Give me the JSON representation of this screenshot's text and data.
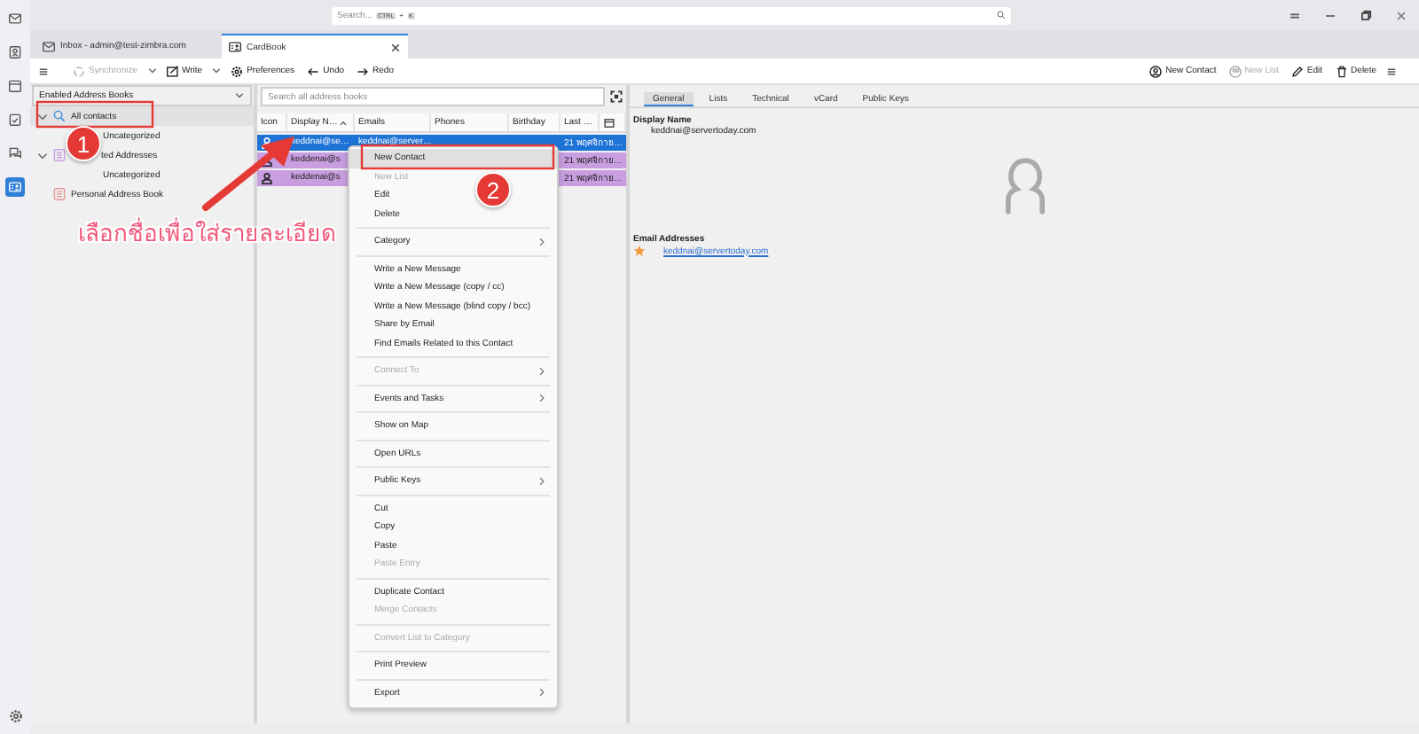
{
  "spaces_bar": {
    "items": [
      {
        "kind": "mail",
        "selected": false
      },
      {
        "kind": "addressbook",
        "selected": false
      },
      {
        "kind": "calendar",
        "selected": false
      },
      {
        "kind": "tasks",
        "selected": false
      },
      {
        "kind": "chat",
        "selected": false
      },
      {
        "kind": "cardbook",
        "selected": true
      }
    ]
  },
  "search": {
    "placeholder": "Search...",
    "shortcut": [
      "CTRL",
      "+",
      "K"
    ]
  },
  "tabs": [
    {
      "label": "Inbox - admin@test-zimbra.com",
      "kind": "mail",
      "selected": false
    },
    {
      "label": "CardBook",
      "kind": "cardbook",
      "selected": true
    }
  ],
  "toolbar": {
    "left": [
      {
        "label": "Synchronize",
        "kind": "sync",
        "disabled": true,
        "has_menu": true
      },
      {
        "label": "Write",
        "kind": "write",
        "disabled": false,
        "has_menu": true
      },
      {
        "label": "Preferences",
        "kind": "prefs",
        "disabled": false,
        "has_menu": false
      },
      {
        "label": "Undo",
        "kind": "undo",
        "disabled": false,
        "has_menu": false
      },
      {
        "label": "Redo",
        "kind": "redo",
        "disabled": false,
        "has_menu": false
      }
    ],
    "right": [
      {
        "label": "New Contact",
        "kind": "new-contact",
        "disabled": false
      },
      {
        "label": "New List",
        "kind": "new-list",
        "disabled": true
      },
      {
        "label": "Edit",
        "kind": "edit",
        "disabled": false
      },
      {
        "label": "Delete",
        "kind": "delete",
        "disabled": false
      }
    ]
  },
  "address_books": {
    "selector": "Enabled Address Books",
    "tree": [
      {
        "label": "All contacts",
        "kind": "search",
        "expanded": true,
        "selected": true,
        "children": [
          {
            "label": "Uncategorized",
            "selected": false
          }
        ]
      },
      {
        "label": "ted Addresses",
        "kind": "book",
        "color": "#c89ee0",
        "expanded": true,
        "selected": false,
        "children": [
          {
            "label": "Uncategorized",
            "selected": false
          }
        ]
      },
      {
        "label": "Personal Address Book",
        "kind": "book",
        "color": "#e89a9a",
        "selected": false
      }
    ]
  },
  "contacts": {
    "search_placeholder": "Search all address books",
    "columns": [
      {
        "label": "Icon",
        "sorted": false
      },
      {
        "label": "Display N…",
        "sorted": true
      },
      {
        "label": "Emails",
        "sorted": false
      },
      {
        "label": "Phones",
        "sorted": false
      },
      {
        "label": "Birthday",
        "sorted": false
      },
      {
        "label": "Last …",
        "sorted": false
      }
    ],
    "rows": [
      {
        "display_name": "keddnai@se…",
        "email": "keddnai@server…",
        "last": "21 พฤศจิกาย…",
        "selected": true
      },
      {
        "display_name": "keddenai@s",
        "last": "21 พฤศจิกาย…",
        "color": "#c89ee0",
        "selected": false
      },
      {
        "display_name": "keddenai@s",
        "last": "21 พฤศจิกาย…",
        "color": "#c89ee0",
        "selected": false
      }
    ]
  },
  "context_menu": {
    "items": [
      {
        "kind": "item",
        "label": "New Contact",
        "selected": true,
        "disabled": false
      },
      {
        "kind": "item",
        "label": "New List",
        "selected": false,
        "disabled": true
      },
      {
        "kind": "item",
        "label": "Edit",
        "selected": false,
        "disabled": false
      },
      {
        "kind": "item",
        "label": "Delete",
        "selected": false,
        "disabled": false
      },
      {
        "kind": "separator"
      },
      {
        "kind": "submenu",
        "label": "Category",
        "selected": false,
        "disabled": false
      },
      {
        "kind": "separator"
      },
      {
        "kind": "item",
        "label": "Write a New Message",
        "selected": false,
        "disabled": false
      },
      {
        "kind": "item",
        "label": "Write a New Message (copy / cc)",
        "selected": false,
        "disabled": false
      },
      {
        "kind": "item",
        "label": "Write a New Message (blind copy / bcc)",
        "selected": false,
        "disabled": false
      },
      {
        "kind": "item",
        "label": "Share by Email",
        "selected": false,
        "disabled": false
      },
      {
        "kind": "item",
        "label": "Find Emails Related to this Contact",
        "selected": false,
        "disabled": false
      },
      {
        "kind": "separator"
      },
      {
        "kind": "submenu",
        "label": "Connect To",
        "selected": false,
        "disabled": true
      },
      {
        "kind": "separator"
      },
      {
        "kind": "submenu",
        "label": "Events and Tasks",
        "selected": false,
        "disabled": false
      },
      {
        "kind": "separator"
      },
      {
        "kind": "item",
        "label": "Show on Map",
        "selected": false,
        "disabled": false
      },
      {
        "kind": "separator"
      },
      {
        "kind": "item",
        "label": "Open URLs",
        "selected": false,
        "disabled": false
      },
      {
        "kind": "separator"
      },
      {
        "kind": "submenu",
        "label": "Public Keys",
        "selected": false,
        "disabled": false
      },
      {
        "kind": "separator"
      },
      {
        "kind": "item",
        "label": "Cut",
        "selected": false,
        "disabled": false
      },
      {
        "kind": "item",
        "label": "Copy",
        "selected": false,
        "disabled": false
      },
      {
        "kind": "item",
        "label": "Paste",
        "selected": false,
        "disabled": false
      },
      {
        "kind": "item",
        "label": "Paste Entry",
        "selected": false,
        "disabled": true
      },
      {
        "kind": "separator"
      },
      {
        "kind": "item",
        "label": "Duplicate Contact",
        "selected": false,
        "disabled": false
      },
      {
        "kind": "item",
        "label": "Merge Contacts",
        "selected": false,
        "disabled": true
      },
      {
        "kind": "separator"
      },
      {
        "kind": "item",
        "label": "Convert List to Category",
        "selected": false,
        "disabled": true
      },
      {
        "kind": "separator"
      },
      {
        "kind": "item",
        "label": "Print Preview",
        "selected": false,
        "disabled": false
      },
      {
        "kind": "separator"
      },
      {
        "kind": "submenu",
        "label": "Export",
        "selected": false,
        "disabled": false
      }
    ]
  },
  "detail": {
    "tabs": [
      {
        "label": "General",
        "selected": true
      },
      {
        "label": "Lists",
        "selected": false
      },
      {
        "label": "Technical",
        "selected": false
      },
      {
        "label": "vCard",
        "selected": false
      },
      {
        "label": "Public Keys",
        "selected": false
      }
    ],
    "display_name_label": "Display Name",
    "display_name": "keddnai@servertoday.com",
    "email_label": "Email Addresses",
    "emails": [
      {
        "address": "keddnai@servertoday.com",
        "preferred": true
      }
    ]
  },
  "annotations": {
    "badges": [
      "1",
      "2"
    ],
    "caption": "เลือกชื่อเพื่อใส่รายละเอียด"
  }
}
